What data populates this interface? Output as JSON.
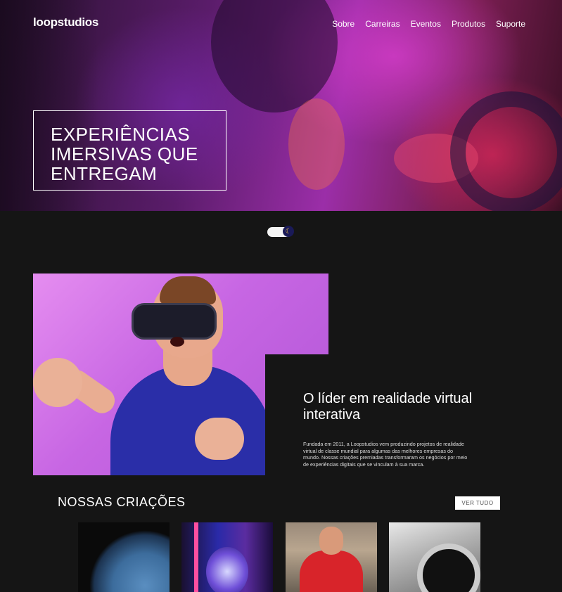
{
  "header": {
    "logo": "loopstudios",
    "nav": [
      "Sobre",
      "Carreiras",
      "Eventos",
      "Produtos",
      "Suporte"
    ]
  },
  "hero": {
    "title_lines": [
      "EXPERIÊNCIAS",
      "IMERSIVAS QUE",
      "ENTREGAM"
    ]
  },
  "theme_toggle": {
    "state": "dark",
    "icon": "moon-icon"
  },
  "about": {
    "title": "O líder em realidade virtual interativa",
    "text": "Fundada em 2011, a Loopstudios vem produzindo projetos de realidade virtual de classe mundial para algumas das melhores empresas do mundo. Nossas criações premiadas transformaram os negócios por meio de experiências digitais que se vinculam à sua marca."
  },
  "creations": {
    "title": "NOSSAS CRIAÇÕES",
    "see_all": "VER TUDO"
  },
  "colors": {
    "background": "#151515",
    "text": "#ffffff",
    "hero_magenta": "#9b2ea8",
    "about_purple": "#c766e3"
  }
}
